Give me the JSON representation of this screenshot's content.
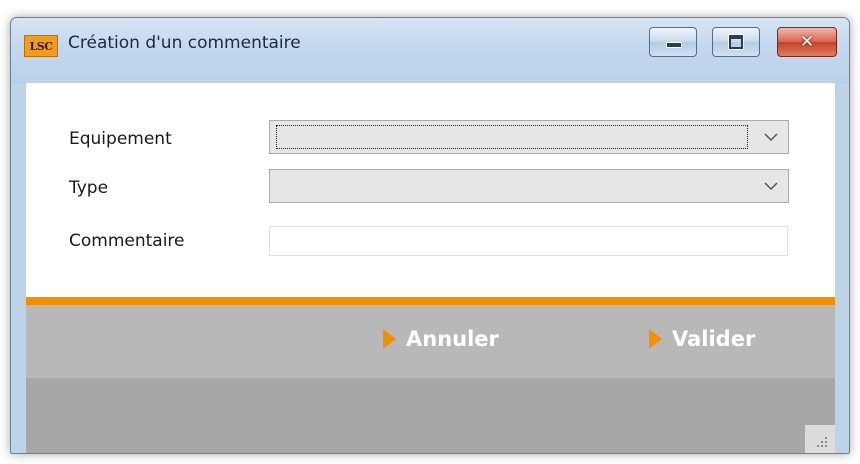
{
  "window": {
    "title": "Création d'un commentaire",
    "app_icon_text": "LSC",
    "icons": {
      "app": "lsc-app-icon",
      "minimize": "minimize-icon",
      "maximize": "maximize-icon",
      "close": "close-icon"
    }
  },
  "form": {
    "equipement_label": "Equipement",
    "equipement_value": "",
    "type_label": "Type",
    "type_value": "",
    "commentaire_label": "Commentaire",
    "commentaire_value": ""
  },
  "actions": {
    "cancel_label": "Annuler",
    "submit_label": "Valider"
  },
  "colors": {
    "accent": "#f29000",
    "button_bar": "#b8b8b8",
    "bottom_bar": "#a7a7a7"
  }
}
